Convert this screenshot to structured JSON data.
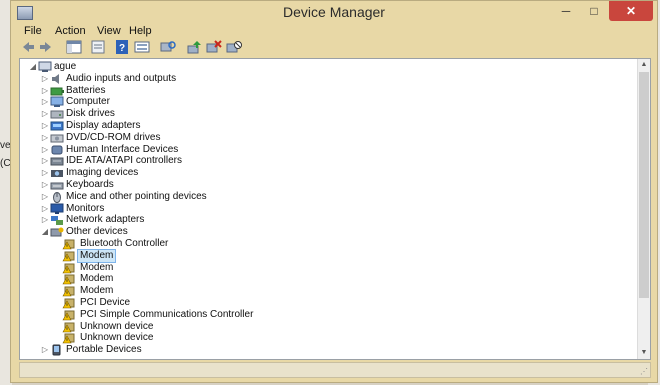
{
  "window": {
    "title": "Device Manager"
  },
  "window_controls": {
    "minimize": "─",
    "maximize": "□",
    "close": "✕"
  },
  "menu": [
    "File",
    "Action",
    "View",
    "Help"
  ],
  "background_fragments": [
    "ve",
    "(C"
  ],
  "tree": [
    {
      "label": "ague",
      "level": 0,
      "toggle": "expanded",
      "icon": "computer-root-icon"
    },
    {
      "label": "Audio inputs and outputs",
      "level": 1,
      "toggle": "collapsed",
      "icon": "speaker-icon"
    },
    {
      "label": "Batteries",
      "level": 1,
      "toggle": "collapsed",
      "icon": "battery-icon"
    },
    {
      "label": "Computer",
      "level": 1,
      "toggle": "collapsed",
      "icon": "computer-icon"
    },
    {
      "label": "Disk drives",
      "level": 1,
      "toggle": "collapsed",
      "icon": "disk-drive-icon"
    },
    {
      "label": "Display adapters",
      "level": 1,
      "toggle": "collapsed",
      "icon": "display-adapter-icon"
    },
    {
      "label": "DVD/CD-ROM drives",
      "level": 1,
      "toggle": "collapsed",
      "icon": "dvd-drive-icon"
    },
    {
      "label": "Human Interface Devices",
      "level": 1,
      "toggle": "collapsed",
      "icon": "hid-icon"
    },
    {
      "label": "IDE ATA/ATAPI controllers",
      "level": 1,
      "toggle": "collapsed",
      "icon": "ide-controller-icon"
    },
    {
      "label": "Imaging devices",
      "level": 1,
      "toggle": "collapsed",
      "icon": "camera-icon"
    },
    {
      "label": "Keyboards",
      "level": 1,
      "toggle": "collapsed",
      "icon": "keyboard-icon"
    },
    {
      "label": "Mice and other pointing devices",
      "level": 1,
      "toggle": "collapsed",
      "icon": "mouse-icon"
    },
    {
      "label": "Monitors",
      "level": 1,
      "toggle": "collapsed",
      "icon": "monitor-icon"
    },
    {
      "label": "Network adapters",
      "level": 1,
      "toggle": "collapsed",
      "icon": "network-icon"
    },
    {
      "label": "Other devices",
      "level": 1,
      "toggle": "expanded",
      "icon": "other-devices-icon"
    },
    {
      "label": "Bluetooth Controller",
      "level": 2,
      "toggle": "none",
      "icon": "warning-device-icon"
    },
    {
      "label": "Modem",
      "level": 2,
      "toggle": "none",
      "icon": "warning-device-icon",
      "selected": true
    },
    {
      "label": "Modem",
      "level": 2,
      "toggle": "none",
      "icon": "warning-device-icon"
    },
    {
      "label": "Modem",
      "level": 2,
      "toggle": "none",
      "icon": "warning-device-icon"
    },
    {
      "label": "Modem",
      "level": 2,
      "toggle": "none",
      "icon": "warning-device-icon"
    },
    {
      "label": "PCI Device",
      "level": 2,
      "toggle": "none",
      "icon": "warning-device-icon"
    },
    {
      "label": "PCI Simple Communications Controller",
      "level": 2,
      "toggle": "none",
      "icon": "warning-device-icon"
    },
    {
      "label": "Unknown device",
      "level": 2,
      "toggle": "none",
      "icon": "warning-device-icon"
    },
    {
      "label": "Unknown device",
      "level": 2,
      "toggle": "none",
      "icon": "warning-device-icon"
    },
    {
      "label": "Portable Devices",
      "level": 1,
      "toggle": "collapsed",
      "icon": "portable-device-icon"
    }
  ],
  "colors": {
    "selection": "#cde6f7",
    "close_button": "#c9463d",
    "warning": "#e8b400"
  }
}
